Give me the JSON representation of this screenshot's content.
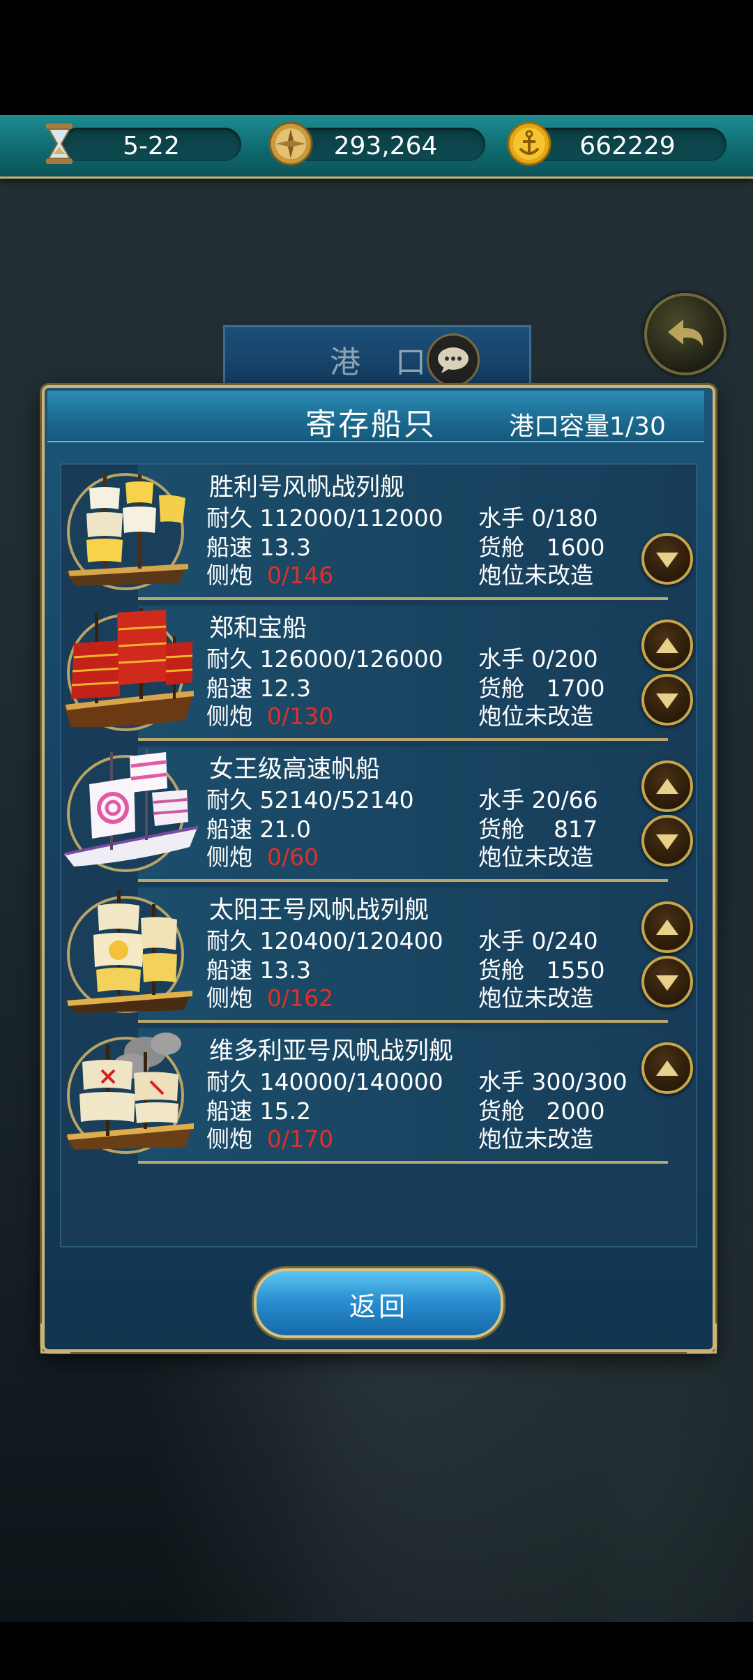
{
  "topbar": {
    "date": "5-22",
    "coins": "293,264",
    "gold": "662229",
    "icons": [
      "hourglass-icon",
      "compass-coin-icon",
      "anchor-coin-icon"
    ]
  },
  "background": {
    "port_label": "港 口"
  },
  "panel": {
    "title": "寄存船只",
    "capacity_label": "港口容量",
    "capacity_value": "1/30",
    "return_label": "返回"
  },
  "labels": {
    "durability": "耐久",
    "speed": "船速",
    "cannon": "侧炮",
    "sailors": "水手",
    "cargo": "货舱"
  },
  "ships": [
    {
      "name": "胜利号风帆战列舰",
      "durability": "112000/112000",
      "speed": "13.3",
      "cannon": "0/146",
      "sailors": "0/180",
      "cargo": "1600",
      "mod": "炮位未改造",
      "up": false,
      "down": true
    },
    {
      "name": "郑和宝船",
      "durability": "126000/126000",
      "speed": "12.3",
      "cannon": "0/130",
      "sailors": "0/200",
      "cargo": "1700",
      "mod": "炮位未改造",
      "up": true,
      "down": true
    },
    {
      "name": "女王级高速帆船",
      "durability": "52140/52140",
      "speed": "21.0",
      "cannon": "0/60",
      "sailors": "20/66",
      "cargo": "817",
      "mod": "炮位未改造",
      "up": true,
      "down": true
    },
    {
      "name": "太阳王号风帆战列舰",
      "durability": "120400/120400",
      "speed": "13.3",
      "cannon": "0/162",
      "sailors": "0/240",
      "cargo": "1550",
      "mod": "炮位未改造",
      "up": true,
      "down": true
    },
    {
      "name": "维多利亚号风帆战列舰",
      "durability": "140000/140000",
      "speed": "15.2",
      "cannon": "0/170",
      "sailors": "300/300",
      "cargo": "2000",
      "mod": "炮位未改造",
      "up": true,
      "down": false
    }
  ],
  "colors": {
    "accent_gold": "#c9b57a",
    "cannon_red": "#e0302a",
    "panel_blue": "#1b5578"
  }
}
